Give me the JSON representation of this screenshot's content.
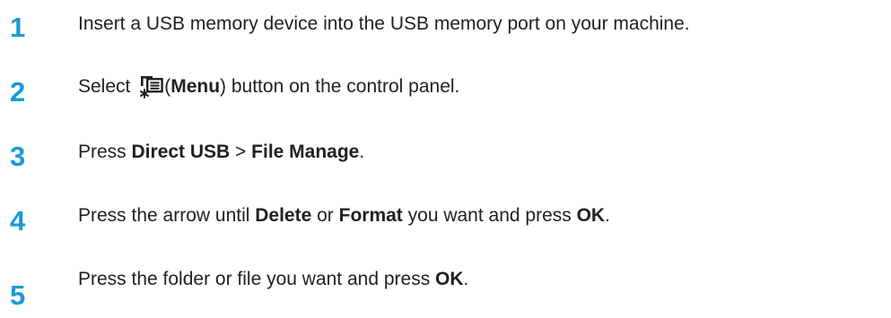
{
  "steps": [
    {
      "number": "1",
      "text": "Insert a USB memory device into the USB memory port on your machine."
    },
    {
      "number": "2",
      "before": "Select ",
      "paren_open": "(",
      "bold": "Menu",
      "after": ") button on the control panel.",
      "icon": "menu-icon"
    },
    {
      "number": "3",
      "t1": "Press ",
      "b1": "Direct USB",
      "t2": " > ",
      "b2": "File Manage",
      "t3": "."
    },
    {
      "number": "4",
      "t1": "Press the arrow until ",
      "b1": "Delete",
      "t2": " or ",
      "b2": "Format",
      "t3": " you want and press ",
      "b3": "OK",
      "t4": "."
    },
    {
      "number": "5",
      "t1": "Press the folder or file you want and press ",
      "b1": "OK",
      "t2": "."
    }
  ],
  "colors": {
    "step_number": "#1a9ad6",
    "text": "#231f20"
  }
}
